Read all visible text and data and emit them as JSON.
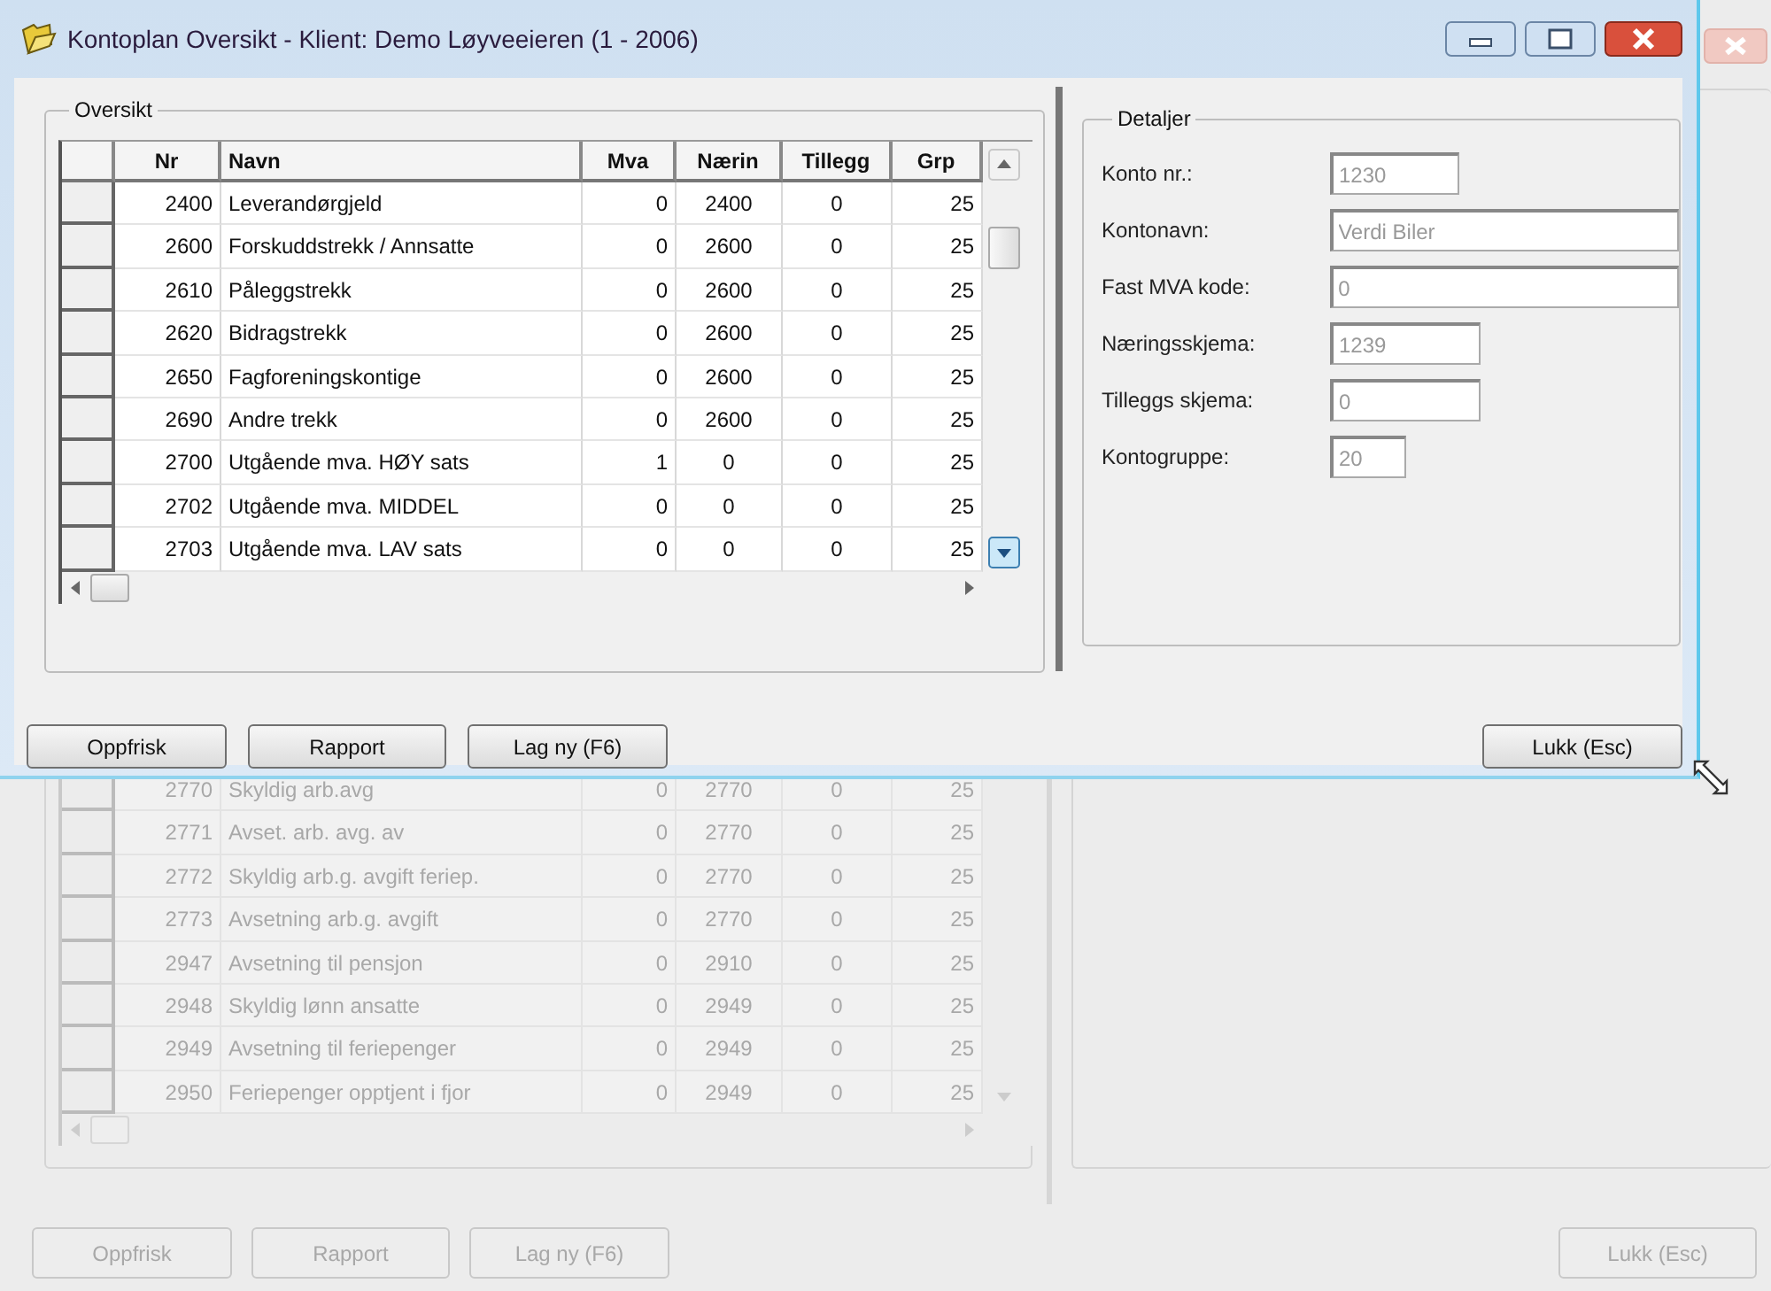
{
  "window": {
    "title": "Kontoplan Oversikt - Klient: Demo Løyveeieren (1 - 2006)"
  },
  "overview": {
    "title": "Oversikt",
    "columns": [
      "Nr",
      "Navn",
      "Mva",
      "Nærin",
      "Tillegg",
      "Grp"
    ],
    "rows": [
      {
        "nr": "2400",
        "navn": "Leverandørgjeld",
        "mva": "0",
        "naering": "2400",
        "tillegg": "0",
        "grp": "25"
      },
      {
        "nr": "2600",
        "navn": "Forskuddstrekk / Annsatte",
        "mva": "0",
        "naering": "2600",
        "tillegg": "0",
        "grp": "25"
      },
      {
        "nr": "2610",
        "navn": "Påleggstrekk",
        "mva": "0",
        "naering": "2600",
        "tillegg": "0",
        "grp": "25"
      },
      {
        "nr": "2620",
        "navn": "Bidragstrekk",
        "mva": "0",
        "naering": "2600",
        "tillegg": "0",
        "grp": "25"
      },
      {
        "nr": "2650",
        "navn": "Fagforeningskontige",
        "mva": "0",
        "naering": "2600",
        "tillegg": "0",
        "grp": "25"
      },
      {
        "nr": "2690",
        "navn": "Andre trekk",
        "mva": "0",
        "naering": "2600",
        "tillegg": "0",
        "grp": "25"
      },
      {
        "nr": "2700",
        "navn": "Utgående mva. HØY sats",
        "mva": "1",
        "naering": "0",
        "tillegg": "0",
        "grp": "25"
      },
      {
        "nr": "2702",
        "navn": "Utgående mva. MIDDEL",
        "mva": "0",
        "naering": "0",
        "tillegg": "0",
        "grp": "25"
      },
      {
        "nr": "2703",
        "navn": "Utgående mva. LAV sats",
        "mva": "0",
        "naering": "0",
        "tillegg": "0",
        "grp": "25"
      }
    ]
  },
  "details": {
    "title": "Detaljer",
    "fields": [
      {
        "label": "Konto nr.:",
        "value": "1230"
      },
      {
        "label": "Kontonavn:",
        "value": "Verdi Biler"
      },
      {
        "label": "Fast MVA kode:",
        "value": "0"
      },
      {
        "label": "Næringsskjema:",
        "value": "1239"
      },
      {
        "label": "Tilleggs skjema:",
        "value": "0"
      },
      {
        "label": "Kontogruppe:",
        "value": "20"
      }
    ]
  },
  "buttons": [
    "Oppfrisk",
    "Rapport",
    "Lag ny (F6)"
  ],
  "close_button": "Lukk (Esc)",
  "background_window": {
    "rows": [
      {
        "nr": "2770",
        "navn": "Skyldig arb.avg",
        "mva": "0",
        "naering": "2770",
        "tillegg": "0",
        "grp": "25"
      },
      {
        "nr": "2771",
        "navn": "Avset. arb. avg. av",
        "mva": "0",
        "naering": "2770",
        "tillegg": "0",
        "grp": "25"
      },
      {
        "nr": "2772",
        "navn": "Skyldig arb.g. avgift feriep.",
        "mva": "0",
        "naering": "2770",
        "tillegg": "0",
        "grp": "25"
      },
      {
        "nr": "2773",
        "navn": "Avsetning arb.g. avgift",
        "mva": "0",
        "naering": "2770",
        "tillegg": "0",
        "grp": "25"
      },
      {
        "nr": "2947",
        "navn": "Avsetning til pensjon",
        "mva": "0",
        "naering": "2910",
        "tillegg": "0",
        "grp": "25"
      },
      {
        "nr": "2948",
        "navn": "Skyldig lønn ansatte",
        "mva": "0",
        "naering": "2949",
        "tillegg": "0",
        "grp": "25"
      },
      {
        "nr": "2949",
        "navn": "Avsetning til feriepenger",
        "mva": "0",
        "naering": "2949",
        "tillegg": "0",
        "grp": "25"
      },
      {
        "nr": "2950",
        "navn": "Feriepenger opptjent i fjor",
        "mva": "0",
        "naering": "2949",
        "tillegg": "0",
        "grp": "25"
      }
    ],
    "buttons": [
      "Oppfrisk",
      "Rapport",
      "Lag ny (F6)"
    ],
    "close_button": "Lukk (Esc)"
  }
}
